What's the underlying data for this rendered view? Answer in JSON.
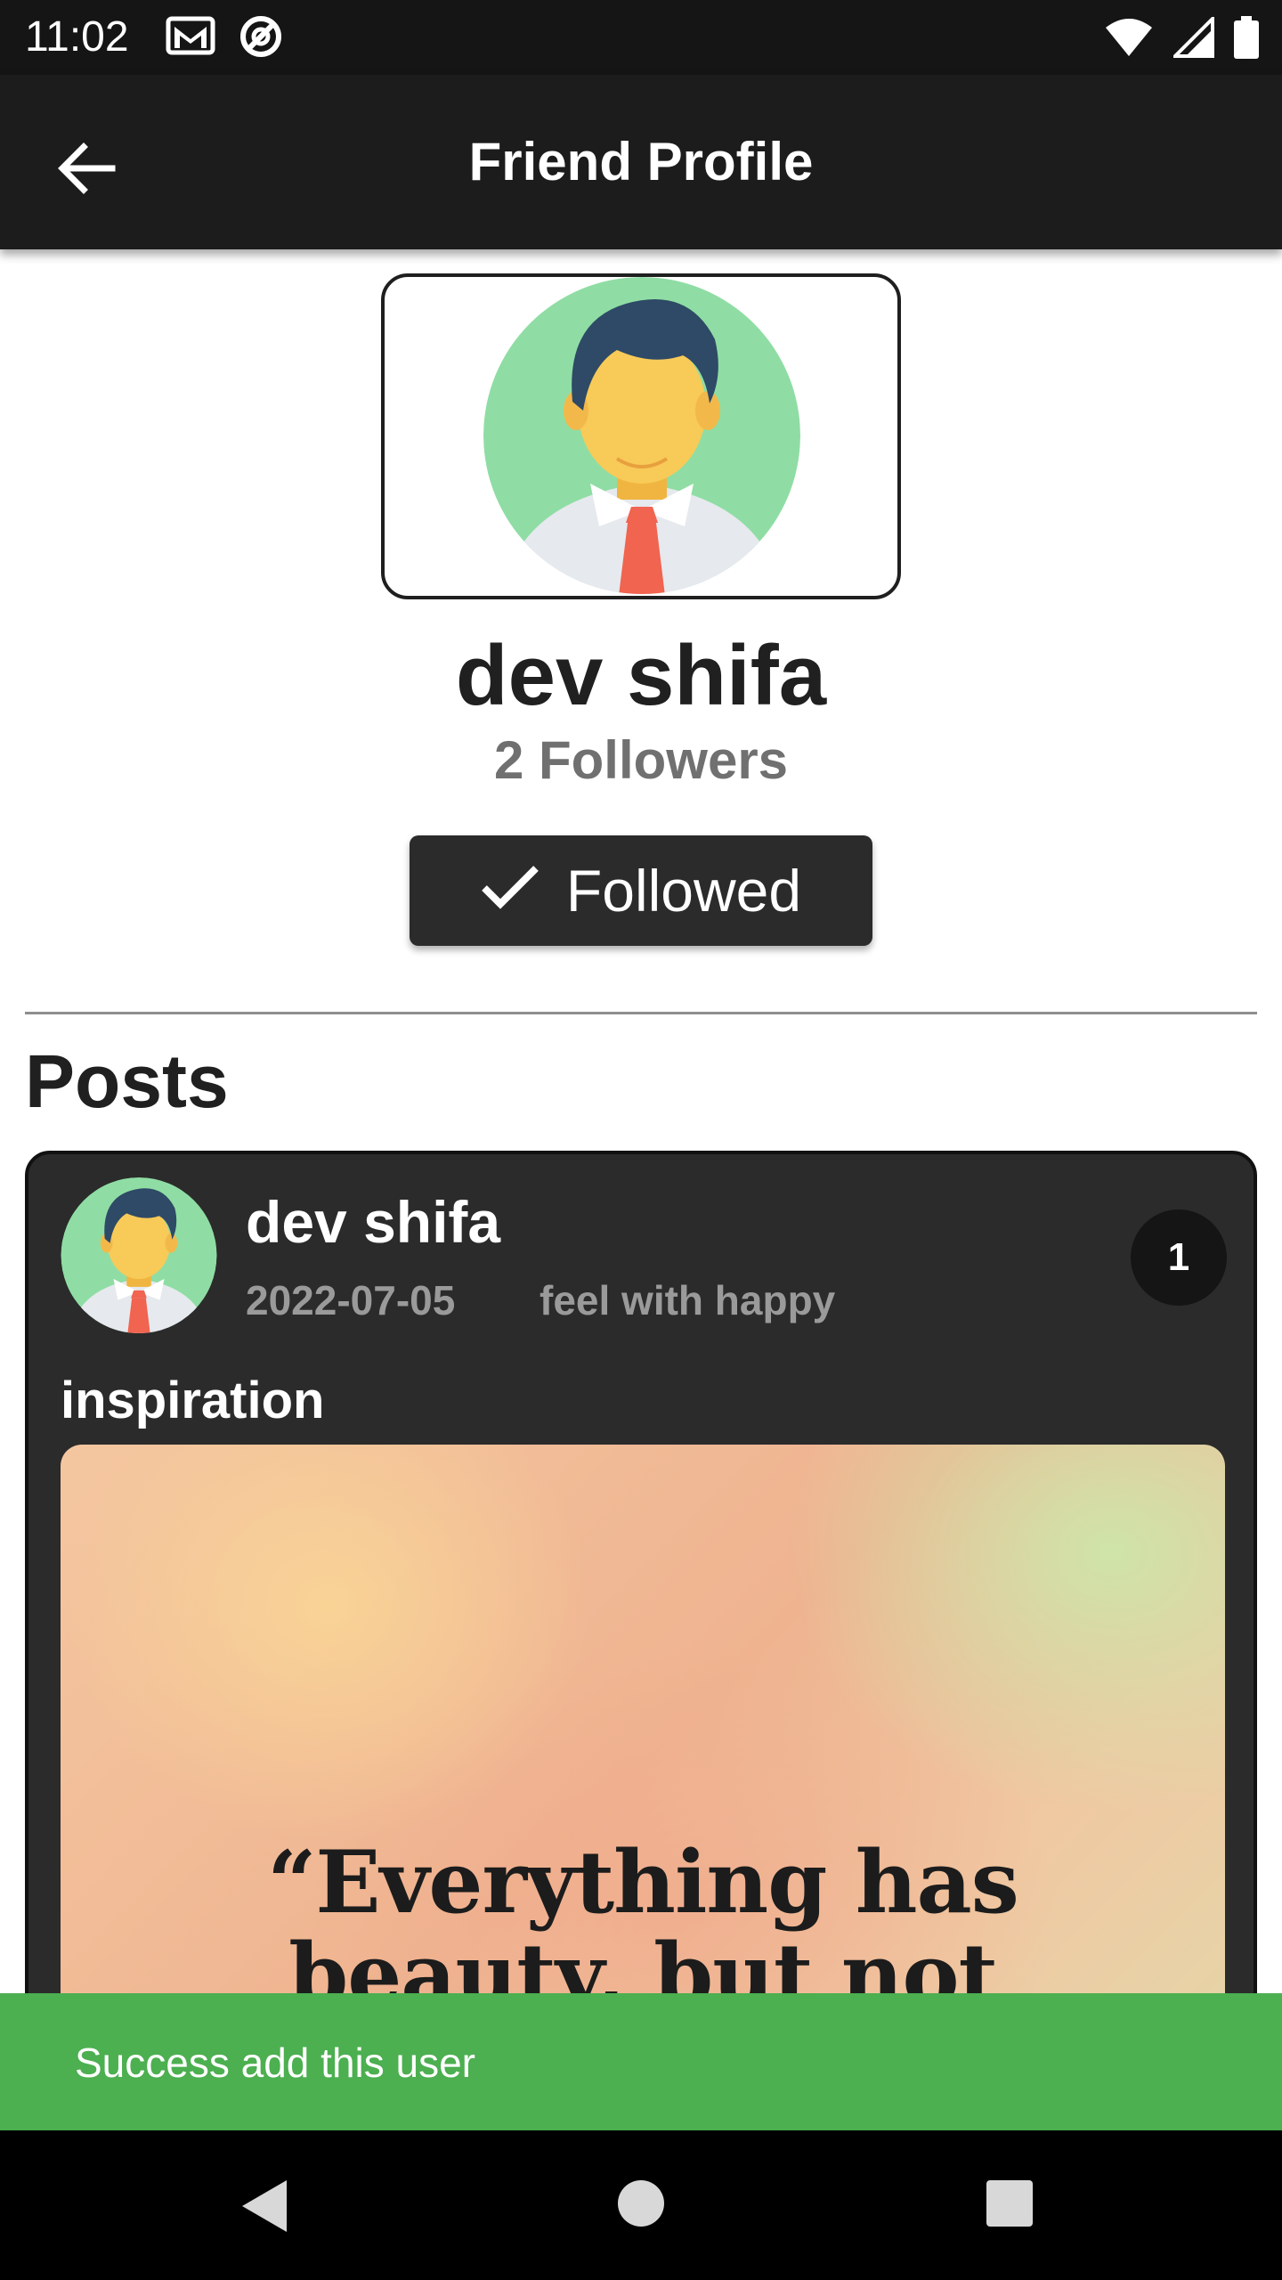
{
  "status_bar": {
    "time": "11:02",
    "left_icons": [
      "gmail-icon",
      "no-disturb-icon"
    ],
    "right_icons": [
      "wifi-icon",
      "signal-icon",
      "battery-icon"
    ]
  },
  "app_bar": {
    "title": "Friend Profile",
    "back_icon": "arrow-back-icon"
  },
  "profile": {
    "name": "dev shifa",
    "followers": "2 Followers",
    "follow_button_label": "Followed",
    "follow_button_icon": "check-icon"
  },
  "posts_section": {
    "title": "Posts",
    "posts": [
      {
        "author": "dev shifa",
        "date": "2022-07-05",
        "feeling": "feel with happy",
        "count": "1",
        "text": "inspiration",
        "image_quote_line1": "“Everything has",
        "image_quote_line2": "beauty, but not"
      }
    ]
  },
  "snackbar": {
    "message": "Success add this user",
    "color": "#4caf50"
  },
  "colors": {
    "app_bar": "#1c1c1c",
    "status_bar": "#151515",
    "card": "#2b2b2b",
    "button": "#2b2b2b",
    "avatar_bg": "#8fdda4"
  }
}
